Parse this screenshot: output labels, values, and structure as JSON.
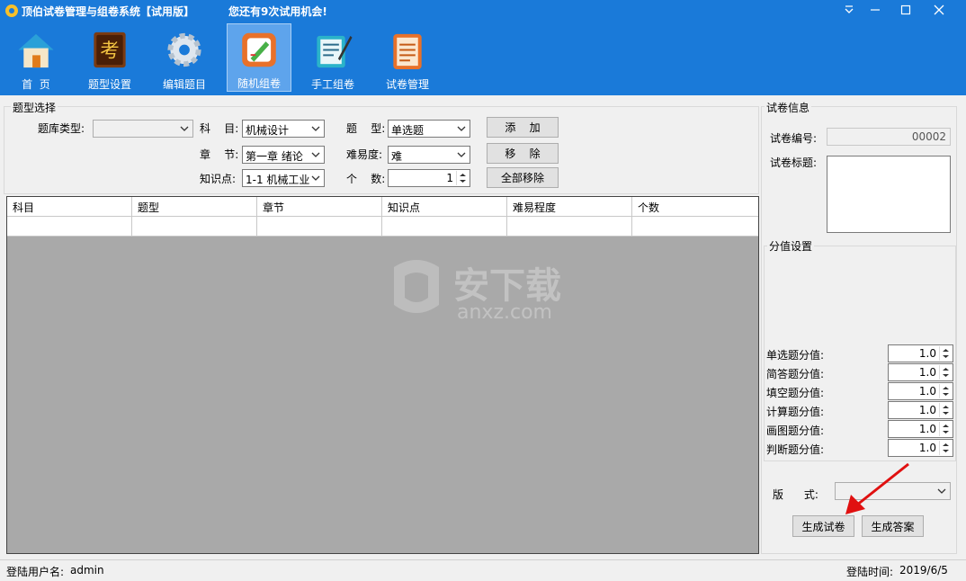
{
  "window": {
    "title": "顶伯试卷管理与组卷系统【试用版】",
    "trial_notice": "您还有9次试用机会!"
  },
  "toolbar": {
    "items": [
      {
        "label": "首  页",
        "icon": "home-icon"
      },
      {
        "label": "题型设置",
        "icon": "book-icon"
      },
      {
        "label": "编辑题目",
        "icon": "gear-icon"
      },
      {
        "label": "随机组卷",
        "icon": "edit-icon",
        "active": true
      },
      {
        "label": "手工组卷",
        "icon": "notebook-pen-icon"
      },
      {
        "label": "试卷管理",
        "icon": "clipboard-icon"
      }
    ]
  },
  "question_select": {
    "title": "题型选择",
    "bank_type_label": "题库类型:",
    "bank_type_value": "",
    "subject_label": "科    目:",
    "subject_value": "机械设计",
    "chapter_label": "章    节:",
    "chapter_value": "第一章 绪论",
    "knowledge_label": "知识点:",
    "knowledge_value": "1-1 机械工业",
    "qtype_label": "题    型:",
    "qtype_value": "单选题",
    "difficulty_label": "难易度:",
    "difficulty_value": "难",
    "count_label": "个    数:",
    "count_value": "1",
    "add_button": "添    加",
    "remove_button": "移    除",
    "remove_all_button": "全部移除"
  },
  "grid": {
    "columns": [
      "科目",
      "题型",
      "章节",
      "知识点",
      "难易程度",
      "个数"
    ],
    "watermark_text": "安下载",
    "watermark_url": "anxz.com"
  },
  "paper_info": {
    "title": "试卷信息",
    "number_label": "试卷编号:",
    "number_value": "00002",
    "title_label": "试卷标题:",
    "score_group_title": "分值设置",
    "scores": [
      {
        "label": "单选题分值:",
        "value": "1.0"
      },
      {
        "label": "简答题分值:",
        "value": "1.0"
      },
      {
        "label": "填空题分值:",
        "value": "1.0"
      },
      {
        "label": "计算题分值:",
        "value": "1.0"
      },
      {
        "label": "画图题分值:",
        "value": "1.0"
      },
      {
        "label": "判断题分值:",
        "value": "1.0"
      }
    ],
    "format_label": "版      式:",
    "format_value": "",
    "generate_paper_button": "生成试卷",
    "generate_answer_button": "生成答案"
  },
  "status": {
    "user_label": "登陆用户名:",
    "user_value": "admin",
    "time_label": "登陆时间:",
    "time_value": "2019/6/5"
  },
  "colors": {
    "title_bar": "#1a7ad9",
    "active_tool": "#5ea4ec",
    "grid_background": "#a9a9a9",
    "annotation_arrow": "#e01010"
  }
}
